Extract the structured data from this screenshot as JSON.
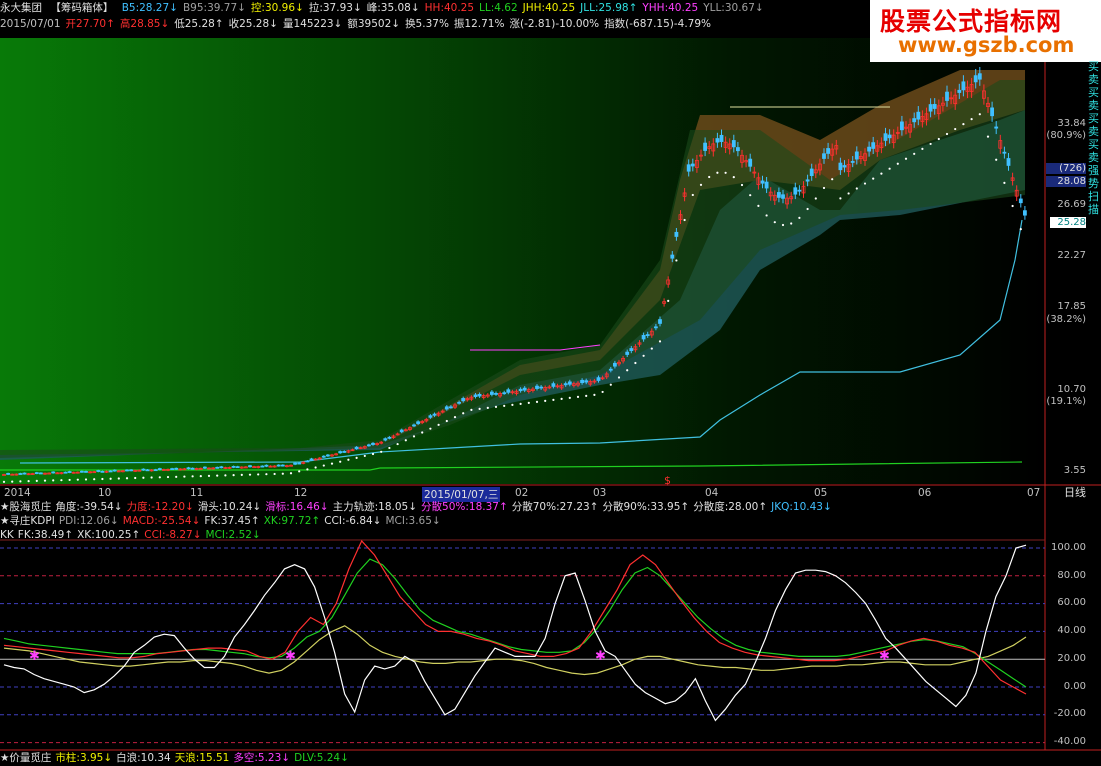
{
  "header": {
    "title": "永大集团",
    "panel_title": "【筹码箱体】",
    "row1": [
      {
        "label": "B5:28.27↓",
        "color": "#40c0ff"
      },
      {
        "label": "B95:39.77↓",
        "color": "#a0a0a0"
      },
      {
        "label": "控:30.96↓",
        "color": "#f0f000"
      },
      {
        "label": "拉:37.93↓",
        "color": "#e0e0e0"
      },
      {
        "label": "峰:35.08↓",
        "color": "#e0e0e0"
      },
      {
        "label": "HH:40.25",
        "color": "#ff3030"
      },
      {
        "label": "LL:4.62",
        "color": "#20d020"
      },
      {
        "label": "JHH:40.25",
        "color": "#f0f000"
      },
      {
        "label": "JLL:25.98↑",
        "color": "#30e0e0"
      },
      {
        "label": "YHH:40.25",
        "color": "#ff40ff"
      },
      {
        "label": "YLL:30.67↓",
        "color": "#a0a0a0"
      }
    ],
    "row2": [
      {
        "label": "2015/07/01",
        "color": "#c0c0c0"
      },
      {
        "label": "开27.70↑",
        "color": "#ff3030"
      },
      {
        "label": "高28.85↓",
        "color": "#ff3030"
      },
      {
        "label": "低25.28↑",
        "color": "#e0e0e0"
      },
      {
        "label": "收25.28↓",
        "color": "#e0e0e0"
      },
      {
        "label": "量145223↓",
        "color": "#e0e0e0"
      },
      {
        "label": "额39502↓",
        "color": "#e0e0e0"
      },
      {
        "label": "换5.37%",
        "color": "#e0e0e0"
      },
      {
        "label": "振12.71%",
        "color": "#e0e0e0"
      },
      {
        "label": "涨(-2.81)-10.00%",
        "color": "#e0e0e0"
      },
      {
        "label": "指数(-687.15)-4.79%",
        "color": "#e0e0e0"
      }
    ]
  },
  "logo": {
    "name": "股票公式指标网",
    "url": "www.gszb.com"
  },
  "price_axis": {
    "ticks": [
      "33.84",
      "(80.9%)",
      "28.08",
      "26.69",
      "22.27",
      "17.85",
      "(38.2%)",
      "10.70",
      "(19.1%)",
      "3.55"
    ],
    "current_badge": "(726)",
    "current_price": "25.28"
  },
  "time_axis": {
    "labels": [
      "2014",
      "10",
      "11",
      "12",
      "2015/01/07,三",
      "02",
      "03",
      "04",
      "05",
      "06",
      "07"
    ],
    "period_button": "日线"
  },
  "indicator_rows": {
    "row1": [
      {
        "label": "★股海觅庄",
        "color": "#e0e0e0"
      },
      {
        "label": "角度:-39.54↓",
        "color": "#e0e0e0"
      },
      {
        "label": "力度:-12.20↓",
        "color": "#ff3030"
      },
      {
        "label": "滑头:10.24↓",
        "color": "#e0e0e0"
      },
      {
        "label": "滑标:16.46↓",
        "color": "#ff40ff"
      },
      {
        "label": "主力轨迹:18.05↓",
        "color": "#e0e0e0"
      },
      {
        "label": "分散50%:18.37↑",
        "color": "#ff40ff"
      },
      {
        "label": "分散70%:27.23↑",
        "color": "#e0e0e0"
      },
      {
        "label": "分散90%:33.95↑",
        "color": "#e0e0e0"
      },
      {
        "label": "分散度:28.00↑",
        "color": "#e0e0e0"
      },
      {
        "label": "JKQ:10.43↓",
        "color": "#40c0ff"
      }
    ],
    "row2": [
      {
        "label": "★寻庄KDPI",
        "color": "#e0e0e0"
      },
      {
        "label": "PDI:12.06↓",
        "color": "#a0a0a0"
      },
      {
        "label": "MACD:-25.54↓",
        "color": "#ff3030"
      },
      {
        "label": "FK:37.45↑",
        "color": "#e0e0e0"
      },
      {
        "label": "XK:97.72↑",
        "color": "#20d020"
      },
      {
        "label": "CCI:-6.84↓",
        "color": "#e0e0e0"
      },
      {
        "label": "MCI:3.65↓",
        "color": "#a0a0a0"
      }
    ],
    "row3": [
      {
        "label": "KK",
        "color": "#e0e0e0"
      },
      {
        "label": "FK:38.49↑",
        "color": "#e0e0e0"
      },
      {
        "label": "XK:100.25↑",
        "color": "#e0e0e0"
      },
      {
        "label": "CCI:-8.27↓",
        "color": "#ff3030"
      },
      {
        "label": "MCI:2.52↓",
        "color": "#20d020"
      }
    ],
    "bottom": [
      {
        "label": "★价量觅庄",
        "color": "#e0e0e0"
      },
      {
        "label": "市柱:3.95↓",
        "color": "#f0f000"
      },
      {
        "label": "白浪:10.34",
        "color": "#e0e0e0"
      },
      {
        "label": "天浪:15.51",
        "color": "#f0f000"
      },
      {
        "label": "多空:5.23↓",
        "color": "#ff40ff"
      },
      {
        "label": "DLV:5.24↓",
        "color": "#20d020"
      }
    ]
  },
  "osc_axis": {
    "ticks": [
      "100.00",
      "80.00",
      "60.00",
      "40.00",
      "20.00",
      "0.00",
      "-20.00",
      "-40.00"
    ]
  },
  "side_text": "买卖买卖买卖买卖强势扫描",
  "sub_chart": {
    "y_range": [
      -45,
      108
    ],
    "white": [
      16,
      14,
      13,
      9,
      6,
      4,
      2,
      0,
      -4,
      -2,
      2,
      8,
      15,
      25,
      30,
      36,
      38,
      37,
      28,
      20,
      14,
      14,
      22,
      36,
      45,
      55,
      66,
      75,
      85,
      88,
      85,
      72,
      50,
      25,
      -5,
      -18,
      5,
      15,
      13,
      15,
      22,
      18,
      4,
      -8,
      -20,
      -16,
      -4,
      8,
      18,
      28,
      25,
      22,
      22,
      22,
      35,
      60,
      80,
      82,
      62,
      40,
      26,
      22,
      12,
      2,
      -4,
      -8,
      -12,
      -10,
      -4,
      6,
      -10,
      -24,
      -16,
      -6,
      2,
      18,
      35,
      55,
      70,
      82,
      84,
      84,
      83,
      80,
      75,
      68,
      60,
      48,
      35,
      28,
      20,
      12,
      4,
      -2,
      -8,
      -14,
      -6,
      10,
      40,
      65,
      80,
      100,
      102
    ],
    "red": [
      30,
      29,
      28,
      27,
      26,
      25,
      24,
      23,
      22,
      21,
      21,
      22,
      24,
      25,
      26,
      27,
      28,
      28,
      27,
      26,
      22,
      20,
      25,
      40,
      50,
      45,
      60,
      85,
      105,
      95,
      80,
      65,
      55,
      45,
      40,
      40,
      38,
      35,
      33,
      30,
      26,
      24,
      22,
      22,
      24,
      28,
      40,
      55,
      70,
      88,
      95,
      88,
      75,
      62,
      50,
      40,
      32,
      28,
      25,
      23,
      22,
      21,
      20,
      19,
      19,
      19,
      20,
      22,
      24,
      26,
      30,
      33,
      35,
      33,
      30,
      28,
      25,
      15,
      5,
      0,
      -5
    ],
    "green": [
      35,
      33,
      31,
      30,
      29,
      28,
      27,
      26,
      25,
      24,
      24,
      24,
      24,
      25,
      26,
      27,
      27,
      26,
      25,
      24,
      22,
      21,
      22,
      28,
      36,
      40,
      50,
      66,
      82,
      92,
      88,
      78,
      66,
      55,
      48,
      44,
      40,
      38,
      35,
      32,
      29,
      27,
      26,
      25,
      25,
      26,
      32,
      42,
      55,
      70,
      82,
      86,
      80,
      70,
      60,
      50,
      42,
      35,
      30,
      27,
      25,
      24,
      23,
      22,
      22,
      22,
      22,
      23,
      25,
      27,
      29,
      31,
      33,
      34,
      33,
      31,
      29,
      24,
      18,
      12,
      6,
      0
    ],
    "yellow": [
      28,
      27,
      26,
      24,
      22,
      20,
      18,
      17,
      16,
      15,
      15,
      16,
      17,
      18,
      18,
      19,
      19,
      18,
      17,
      15,
      12,
      10,
      12,
      18,
      26,
      34,
      40,
      44,
      38,
      30,
      25,
      22,
      20,
      18,
      17,
      17,
      18,
      18,
      19,
      20,
      20,
      19,
      17,
      14,
      12,
      10,
      9,
      10,
      13,
      16,
      20,
      22,
      22,
      20,
      18,
      16,
      15,
      14,
      14,
      13,
      12,
      12,
      13,
      14,
      15,
      15,
      15,
      16,
      16,
      17,
      18,
      18,
      17,
      16,
      16,
      16,
      18,
      20,
      22,
      26,
      30,
      36
    ]
  }
}
